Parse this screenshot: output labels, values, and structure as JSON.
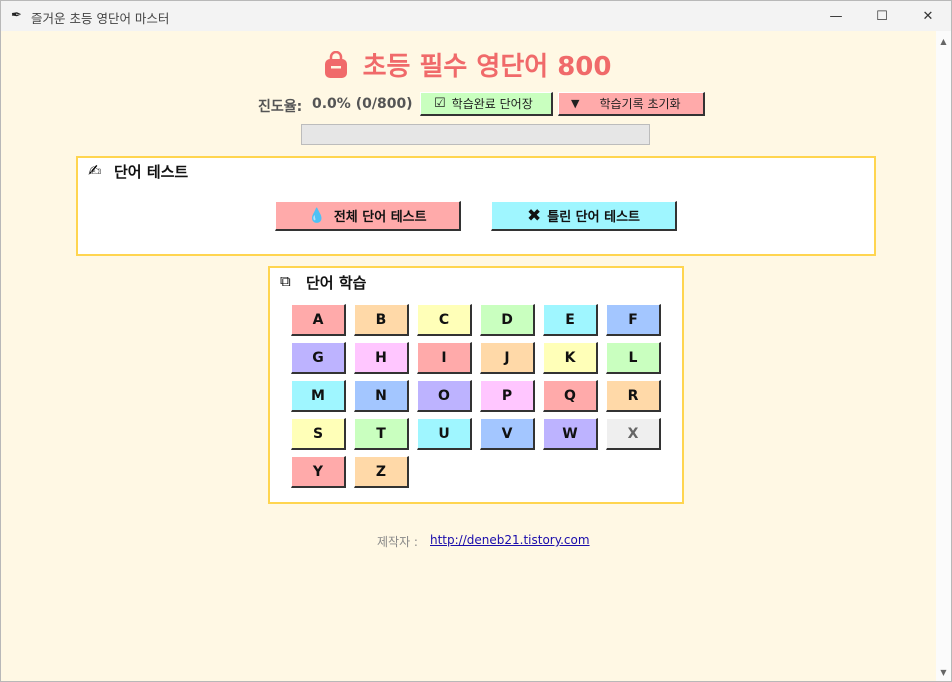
{
  "window": {
    "title": "즐거운 초등 영단어 마스터",
    "minimize": "—",
    "maximize": "☐",
    "close": "✕"
  },
  "header": {
    "title": "초등 필수 영단어 800"
  },
  "progress": {
    "label": "진도율:",
    "value": "0.0% (0/800)",
    "fraction": 0.0,
    "btn_done": "학습완료 단어장",
    "btn_reset": "학습기록 초기화"
  },
  "test_section": {
    "title": "단어 테스트",
    "btn_all": "전체 단어 테스트",
    "btn_wrong": "틀린 단어 테스트"
  },
  "study_section": {
    "title": "단어 학습",
    "letters": [
      {
        "label": "A",
        "color": "#ffaaaa",
        "enabled": true
      },
      {
        "label": "B",
        "color": "#ffd9a8",
        "enabled": true
      },
      {
        "label": "C",
        "color": "#ffffb8",
        "enabled": true
      },
      {
        "label": "D",
        "color": "#c9ffbf",
        "enabled": true
      },
      {
        "label": "E",
        "color": "#9ff6ff",
        "enabled": true
      },
      {
        "label": "F",
        "color": "#a3c6ff",
        "enabled": true
      },
      {
        "label": "G",
        "color": "#bdb3ff",
        "enabled": true
      },
      {
        "label": "H",
        "color": "#ffc6ff",
        "enabled": true
      },
      {
        "label": "I",
        "color": "#ffaaaa",
        "enabled": true
      },
      {
        "label": "J",
        "color": "#ffd9a8",
        "enabled": true
      },
      {
        "label": "K",
        "color": "#ffffb8",
        "enabled": true
      },
      {
        "label": "L",
        "color": "#c9ffbf",
        "enabled": true
      },
      {
        "label": "M",
        "color": "#9ff6ff",
        "enabled": true
      },
      {
        "label": "N",
        "color": "#a3c6ff",
        "enabled": true
      },
      {
        "label": "O",
        "color": "#bdb3ff",
        "enabled": true
      },
      {
        "label": "P",
        "color": "#ffc6ff",
        "enabled": true
      },
      {
        "label": "Q",
        "color": "#ffaaaa",
        "enabled": true
      },
      {
        "label": "R",
        "color": "#ffd9a8",
        "enabled": true
      },
      {
        "label": "S",
        "color": "#ffffb8",
        "enabled": true
      },
      {
        "label": "T",
        "color": "#c9ffbf",
        "enabled": true
      },
      {
        "label": "U",
        "color": "#9ff6ff",
        "enabled": true
      },
      {
        "label": "V",
        "color": "#a3c6ff",
        "enabled": true
      },
      {
        "label": "W",
        "color": "#bdb3ff",
        "enabled": true
      },
      {
        "label": "X",
        "color": "#efefef",
        "enabled": false
      },
      {
        "label": "Y",
        "color": "#ffaaaa",
        "enabled": true
      },
      {
        "label": "Z",
        "color": "#ffd9a8",
        "enabled": true
      }
    ]
  },
  "credit": {
    "label": "제작자 :",
    "link": "http://deneb21.tistory.com"
  },
  "colors": {
    "title": "#f06a6a",
    "btn_done": "#c9ffbf",
    "btn_reset": "#ffaaaa",
    "btn_all": "#ffaaaa",
    "btn_wrong": "#9ff6ff",
    "frame_border": "#ffd54f",
    "background": "#fff8e4"
  }
}
